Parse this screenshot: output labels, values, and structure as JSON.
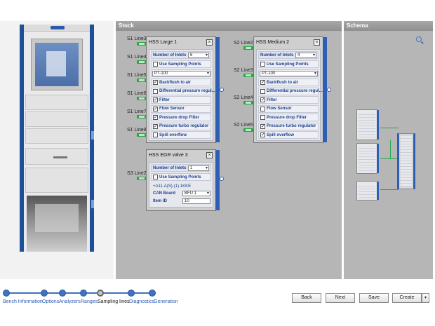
{
  "sections": {
    "stock": "Stock",
    "schema": "Schema"
  },
  "line_labels": {
    "s1l3": "S1 Line3",
    "s1l4": "S1 Line4",
    "s1l5": "S1 Line5",
    "s1l6": "S1 Line6",
    "s1l7": "S1 Line7",
    "s1l8": "S1 Line8",
    "s3l2": "S3 Line2",
    "s2l2": "S2 Line2",
    "s2l3": "S2 Line3",
    "s2l4": "S2 Line4",
    "s2l5": "S2 Line5"
  },
  "card_large": {
    "title": "HSS Large 1",
    "inlets_label": "Number of Inlets",
    "inlets_value": "6",
    "use_sampling": "Use Sampling Points",
    "sensor": "PT-100",
    "items": [
      {
        "label": "Backflush to air",
        "checked": "✓"
      },
      {
        "label": "Differential pressure regul...",
        "checked": ""
      },
      {
        "label": "Filter",
        "checked": "✓"
      },
      {
        "label": "Flow Sensor",
        "checked": "✓"
      },
      {
        "label": "Pressure drop Filter",
        "checked": "✓"
      },
      {
        "label": "Pressure turbo regulator",
        "checked": "✓"
      },
      {
        "label": "Spill overflow",
        "checked": ""
      }
    ]
  },
  "card_medium": {
    "title": "HSS Medium 2",
    "inlets_label": "Number of Inlets",
    "inlets_value": "4",
    "use_sampling": "Use Sampling Points",
    "sensor": "PT-100",
    "items": [
      {
        "label": "Backflush to air",
        "checked": "✓"
      },
      {
        "label": "Differential pressure regul...",
        "checked": ""
      },
      {
        "label": "Filter",
        "checked": "✓"
      },
      {
        "label": "Flow Sensor",
        "checked": ""
      },
      {
        "label": "Pressure drop Filter",
        "checked": ""
      },
      {
        "label": "Pressure turbo regulator",
        "checked": "✓"
      },
      {
        "label": "Spill overflow",
        "checked": "✓"
      }
    ]
  },
  "card_egr": {
    "title": "HSS EGR valve 3",
    "inlets_label": "Number of Inlets",
    "inlets_value": "1",
    "use_sampling": "Use Sampling Points",
    "code": "+A11-A(S)-(1).1KKE",
    "can_label": "CAN Board",
    "can_value": "BFU 1",
    "item_label": "Item ID",
    "item_value": "10"
  },
  "wizard": {
    "steps": [
      "Bench Information",
      "Options",
      "Analyzers",
      "Ranges",
      "Sampling lines",
      "Diagnostics",
      "Generation"
    ],
    "active": "Sampling lines"
  },
  "buttons": {
    "back": "Back",
    "next": "Next",
    "save": "Save",
    "create": "Create",
    "create_dropdown": "▾"
  },
  "colors": {
    "accent": "#2e5fb5",
    "connector": "#22aa44",
    "panel": "#b6b6b6"
  }
}
